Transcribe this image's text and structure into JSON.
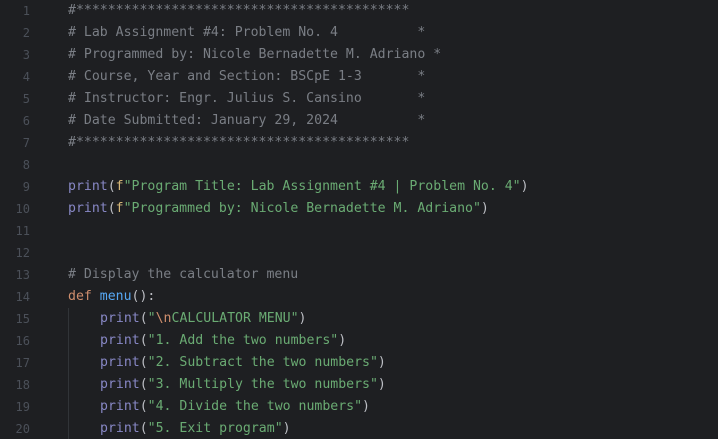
{
  "line_numbers": [
    "1",
    "2",
    "3",
    "4",
    "5",
    "6",
    "7",
    "8",
    "9",
    "10",
    "11",
    "12",
    "13",
    "14",
    "15",
    "16",
    "17",
    "18",
    "19",
    "20"
  ],
  "lines": {
    "l1": {
      "comment": "#******************************************"
    },
    "l2": {
      "comment": "# Lab Assignment #4: Problem No. 4          *"
    },
    "l3": {
      "comment": "# Programmed by: Nicole Bernadette M. Adriano *"
    },
    "l4": {
      "comment": "# Course, Year and Section: BSCpE 1-3       *"
    },
    "l5": {
      "comment": "# Instructor: Engr. Julius S. Cansino       *"
    },
    "l6": {
      "comment": "# Date Submitted: January 29, 2024          *"
    },
    "l7": {
      "comment": "#******************************************"
    },
    "l9": {
      "func": "print",
      "open": "(",
      "prefix": "f",
      "string": "\"Program Title: Lab Assignment #4 | Problem No. 4\"",
      "close": ")"
    },
    "l10": {
      "func": "print",
      "open": "(",
      "prefix": "f",
      "string": "\"Programmed by: Nicole Bernadette M. Adriano\"",
      "close": ")"
    },
    "l13": {
      "comment": "# Display the calculator menu"
    },
    "l14": {
      "keyword": "def",
      "name": "menu",
      "rest": "():"
    },
    "l15": {
      "func": "print",
      "open": "(",
      "q": "\"",
      "escape": "\\n",
      "string": "CALCULATOR MENU\"",
      "close": ")"
    },
    "l16": {
      "func": "print",
      "open": "(",
      "string": "\"1. Add the two numbers\"",
      "close": ")"
    },
    "l17": {
      "func": "print",
      "open": "(",
      "string": "\"2. Subtract the two numbers\"",
      "close": ")"
    },
    "l18": {
      "func": "print",
      "open": "(",
      "string": "\"3. Multiply the two numbers\"",
      "close": ")"
    },
    "l19": {
      "func": "print",
      "open": "(",
      "string": "\"4. Divide the two numbers\"",
      "close": ")"
    },
    "l20": {
      "func": "print",
      "open": "(",
      "string": "\"5. Exit program\"",
      "close": ")"
    }
  }
}
